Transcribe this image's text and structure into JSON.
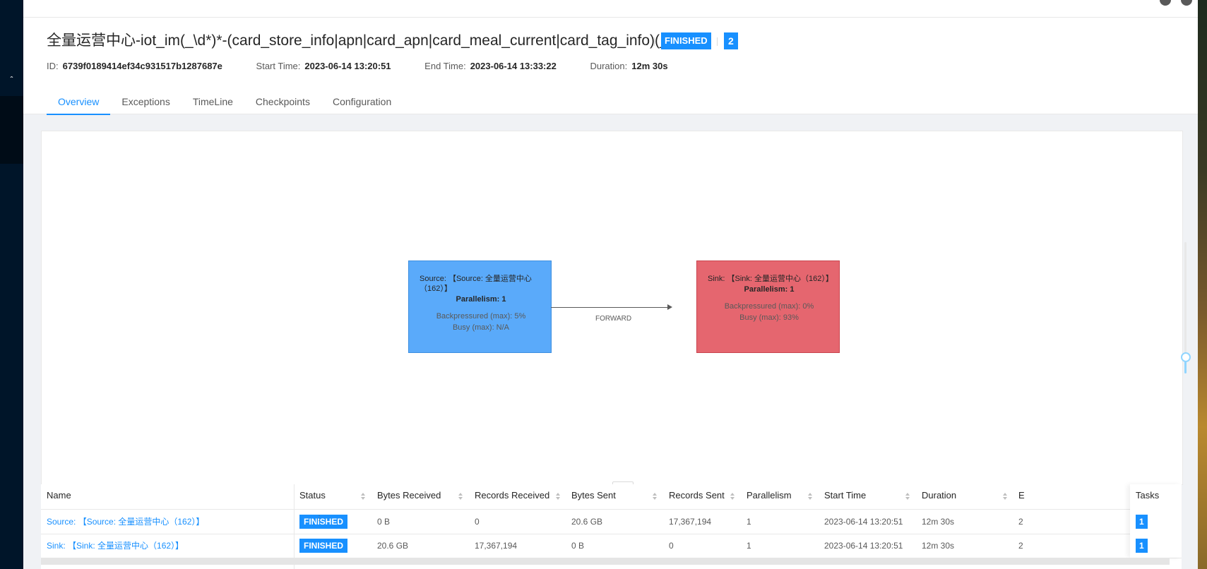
{
  "job": {
    "title": "全量运营中心-iot_im(_\\d*)*-(card_store_info|apn|card_apn|card_meal_current|card_tag_info)(_\\d*)*",
    "status": "FINISHED",
    "count": "2",
    "id_label": "ID:",
    "id": "6739f0189414ef34c931517b1287687e",
    "start_label": "Start Time:",
    "start": "2023-06-14 13:20:51",
    "end_label": "End Time:",
    "end": "2023-06-14 13:33:22",
    "duration_label": "Duration:",
    "duration": "12m 30s"
  },
  "tabs": [
    "Overview",
    "Exceptions",
    "TimeLine",
    "Checkpoints",
    "Configuration"
  ],
  "graph": {
    "source": {
      "name": "Source: 【Source: 全量运营中心（162）】",
      "parallelism": "Parallelism: 1",
      "backpressure": "Backpressured (max): 5%",
      "busy": "Busy (max): N/A"
    },
    "sink": {
      "name": "Sink: 【Sink: 全量运营中心（162）】",
      "parallelism": "Parallelism: 1",
      "backpressure": "Backpressured (max): 0%",
      "busy": "Busy (max): 93%"
    },
    "edge_label": "FORWARD",
    "resize_handle": "...",
    "zoom_level": 0.15
  },
  "table": {
    "columns": [
      "Name",
      "Status",
      "Bytes Received",
      "Records Received",
      "Bytes Sent",
      "Records Sent",
      "Parallelism",
      "Start Time",
      "Duration",
      "E",
      "Tasks"
    ],
    "rows": [
      {
        "name": "Source: 【Source: 全量运营中心（162）】",
        "status": "FINISHED",
        "bytes_received": "0 B",
        "records_received": "0",
        "bytes_sent": "20.6 GB",
        "records_sent": "17,367,194",
        "parallelism": "1",
        "start_time": "2023-06-14 13:20:51",
        "duration": "12m 30s",
        "end": "2",
        "tasks": "1"
      },
      {
        "name": "Sink: 【Sink: 全量运营中心（162）】",
        "status": "FINISHED",
        "bytes_received": "20.6 GB",
        "records_received": "17,367,194",
        "bytes_sent": "0 B",
        "records_sent": "0",
        "parallelism": "1",
        "start_time": "2023-06-14 13:20:51",
        "duration": "12m 30s",
        "end": "2",
        "tasks": "1"
      }
    ]
  },
  "colors": {
    "accent": "#1890ff",
    "source_node": "#5aaafa",
    "sink_node": "#e5666f",
    "nav_bg": "#001529"
  },
  "icons": {
    "collapse": "chevron-up-icon",
    "sort": "sort-icon"
  }
}
